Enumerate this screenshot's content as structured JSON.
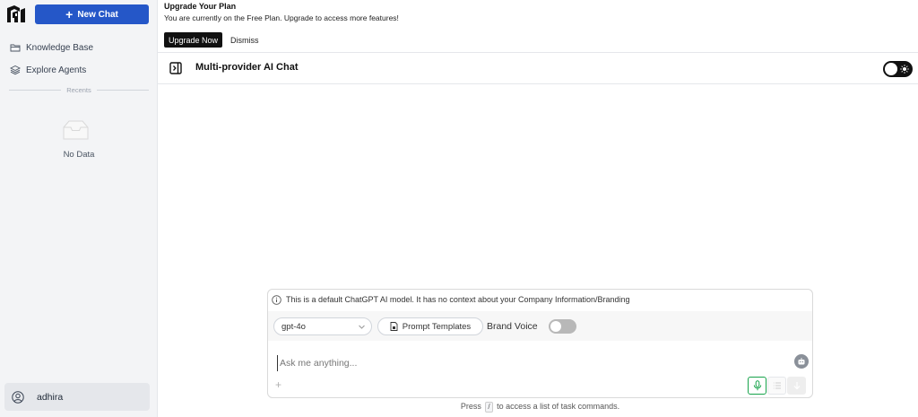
{
  "sidebar": {
    "new_chat_label": "New Chat",
    "items": [
      {
        "label": "Knowledge Base",
        "icon": "folder-icon"
      },
      {
        "label": "Explore Agents",
        "icon": "layers-icon"
      }
    ],
    "recents_label": "Recents",
    "empty_label": "No Data",
    "user_name": "adhira"
  },
  "banner": {
    "title": "Upgrade Your Plan",
    "message": "You are currently on the Free Plan. Upgrade to access more features!",
    "upgrade_label": "Upgrade Now",
    "dismiss_label": "Dismiss"
  },
  "header": {
    "title": "Multi-provider AI Chat"
  },
  "composer": {
    "info": "This is a default ChatGPT AI model. It has no context about your Company Information/Branding",
    "model": "gpt-4o",
    "prompt_templates_label": "Prompt Templates",
    "brand_voice_label": "Brand Voice",
    "placeholder": "Ask me anything...",
    "attach_symbol": "+"
  },
  "hint": {
    "before": "Press",
    "key": "/",
    "after": "to access a list of task commands."
  },
  "colors": {
    "accent": "#2557c8",
    "mic": "#16a34a"
  }
}
